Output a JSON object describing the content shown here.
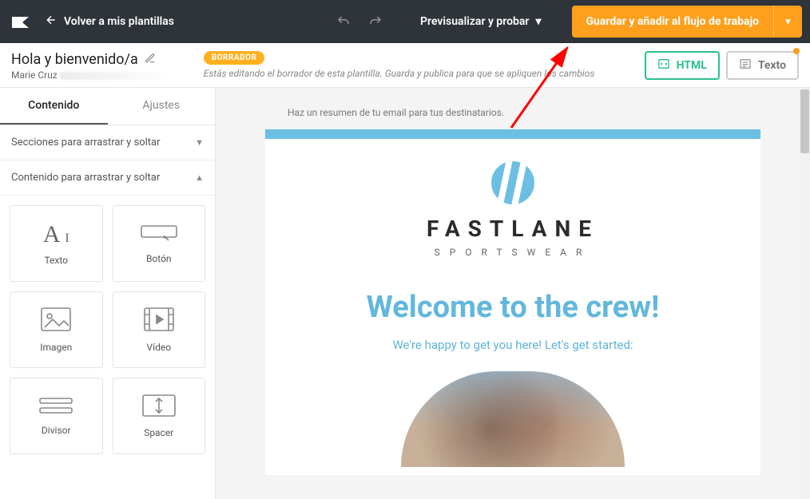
{
  "topbar": {
    "back_label": "Volver a mis plantillas",
    "preview_label": "Previsualizar y probar",
    "save_label": "Guardar y añadir al flujo de trabajo"
  },
  "subheader": {
    "title": "Hola y bienvenido/a",
    "author": "Marie Cruz",
    "badge": "BORRADOR",
    "note": "Estás editando el borrador de esta plantilla. Guarda y publica para que se apliquen los cambios",
    "view_html": "HTML",
    "view_text": "Texto"
  },
  "left": {
    "tabs": {
      "content": "Contenido",
      "settings": "Ajustes"
    },
    "section_drag": "Secciones para arrastrar y soltar",
    "content_drag": "Contenido para arrastrar y soltar",
    "tiles": {
      "text": "Texto",
      "button": "Botón",
      "image": "Imagen",
      "video": "Vídeo",
      "divider": "Divisor",
      "spacer": "Spacer"
    }
  },
  "email": {
    "preheader": "Haz un resumen de tu email para tus destinatarios.",
    "brand_name": "FASTLANE",
    "brand_sub": "SPORTSWEAR",
    "welcome_h": "Welcome to the crew!",
    "welcome_p": "We're happy to get you here! Let's get started:"
  }
}
